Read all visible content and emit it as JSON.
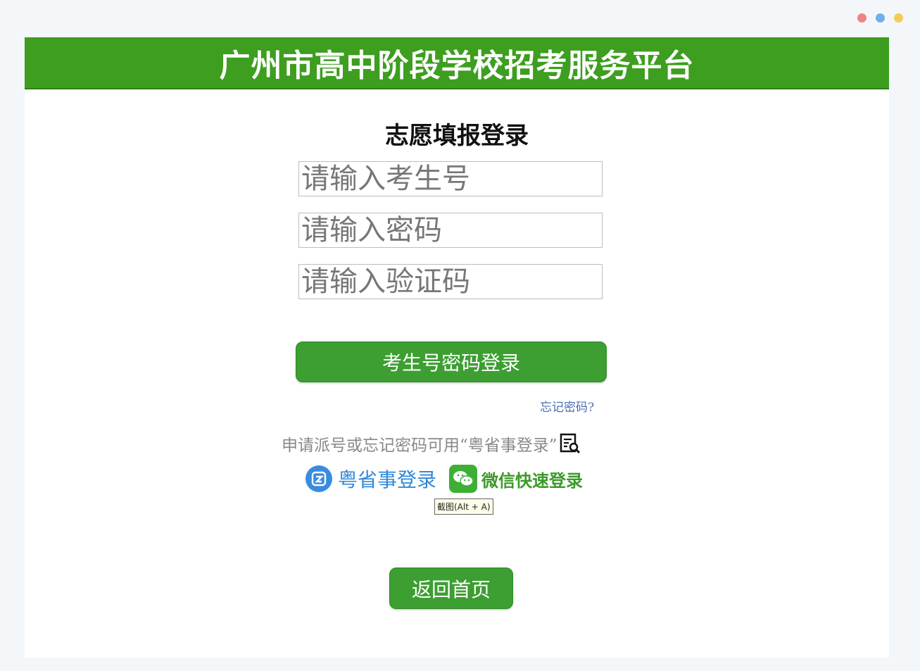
{
  "window": {
    "dot_colors": [
      "#f08484",
      "#6fb0e8",
      "#f2cc5a"
    ]
  },
  "header": {
    "title": "广州市高中阶段学校招考服务平台",
    "color": "#3d9e1f"
  },
  "login": {
    "title": "志愿填报登录",
    "student_id_placeholder": "请输入考生号",
    "password_placeholder": "请输入密码",
    "captcha_placeholder": "请输入验证码",
    "submit_label": "考生号密码登录",
    "forgot_label": "忘记密码?"
  },
  "hint": {
    "text": "申请派号或忘记密码可用“粤省事登录”"
  },
  "alt_logins": {
    "yueshengshi_label": "粤省事登录",
    "wechat_label": "微信快速登录"
  },
  "tooltip": {
    "text": "截图(Alt + A)"
  },
  "footer": {
    "home_label": "返回首页"
  },
  "icons": {
    "window_dots": "window-control-dots",
    "yueshengshi": "yueshengshi-logo-icon",
    "wechat": "wechat-icon",
    "guide": "document-search-icon"
  }
}
